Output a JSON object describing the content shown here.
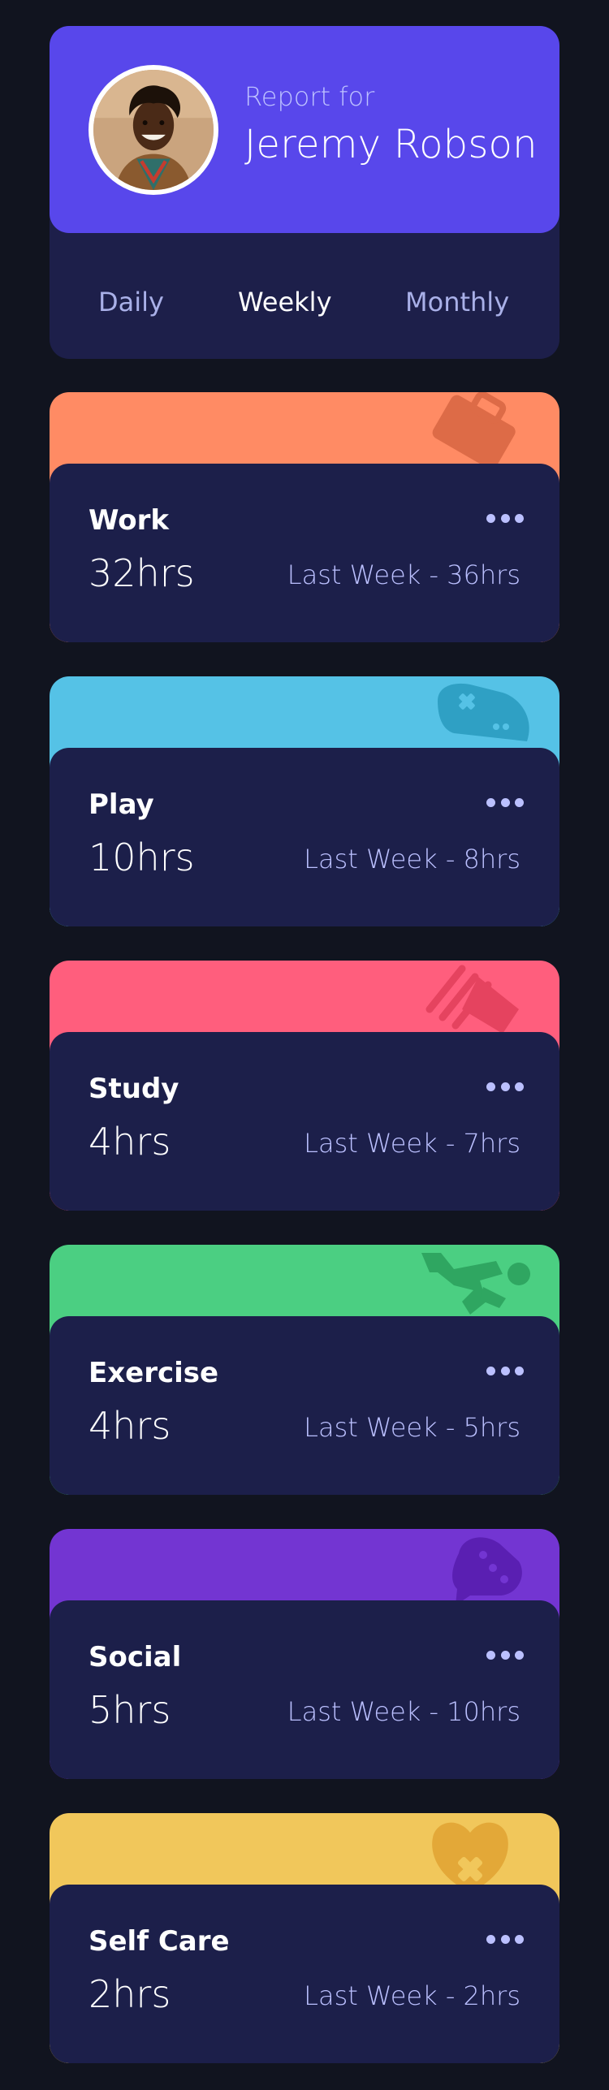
{
  "profile": {
    "report_for": "Report for",
    "name": "Jeremy Robson"
  },
  "tabs": [
    {
      "label": "Daily"
    },
    {
      "label": "Weekly"
    },
    {
      "label": "Monthly"
    }
  ],
  "active_tab": "Weekly",
  "activities": [
    {
      "title": "Work",
      "current": "32hrs",
      "previous": "Last Week - 36hrs",
      "color": "#ff8b64",
      "icon": "briefcase-icon",
      "icon_color": "#dd6b47"
    },
    {
      "title": "Play",
      "current": "10hrs",
      "previous": "Last Week - 8hrs",
      "color": "#55c2e6",
      "icon": "gamepad-icon",
      "icon_color": "#2fa0c4"
    },
    {
      "title": "Study",
      "current": "4hrs",
      "previous": "Last Week - 7hrs",
      "color": "#ff5e7d",
      "icon": "books-icon",
      "icon_color": "#e5435f"
    },
    {
      "title": "Exercise",
      "current": "4hrs",
      "previous": "Last Week - 5hrs",
      "color": "#4bcf82",
      "icon": "runner-icon",
      "icon_color": "#2fa661"
    },
    {
      "title": "Social",
      "current": "5hrs",
      "previous": "Last Week - 10hrs",
      "color": "#7335d2",
      "icon": "chat-bubbles-icon",
      "icon_color": "#5a1fb2"
    },
    {
      "title": "Self Care",
      "current": "2hrs",
      "previous": "Last Week - 2hrs",
      "color": "#f1c75b",
      "icon": "heart-icon",
      "icon_color": "#e3a838"
    }
  ],
  "colors": {
    "page_bg": "#11141f",
    "card_bg": "#1c1f4a",
    "profile_accent": "#5847eb",
    "muted_text": "#bbc0ff"
  }
}
